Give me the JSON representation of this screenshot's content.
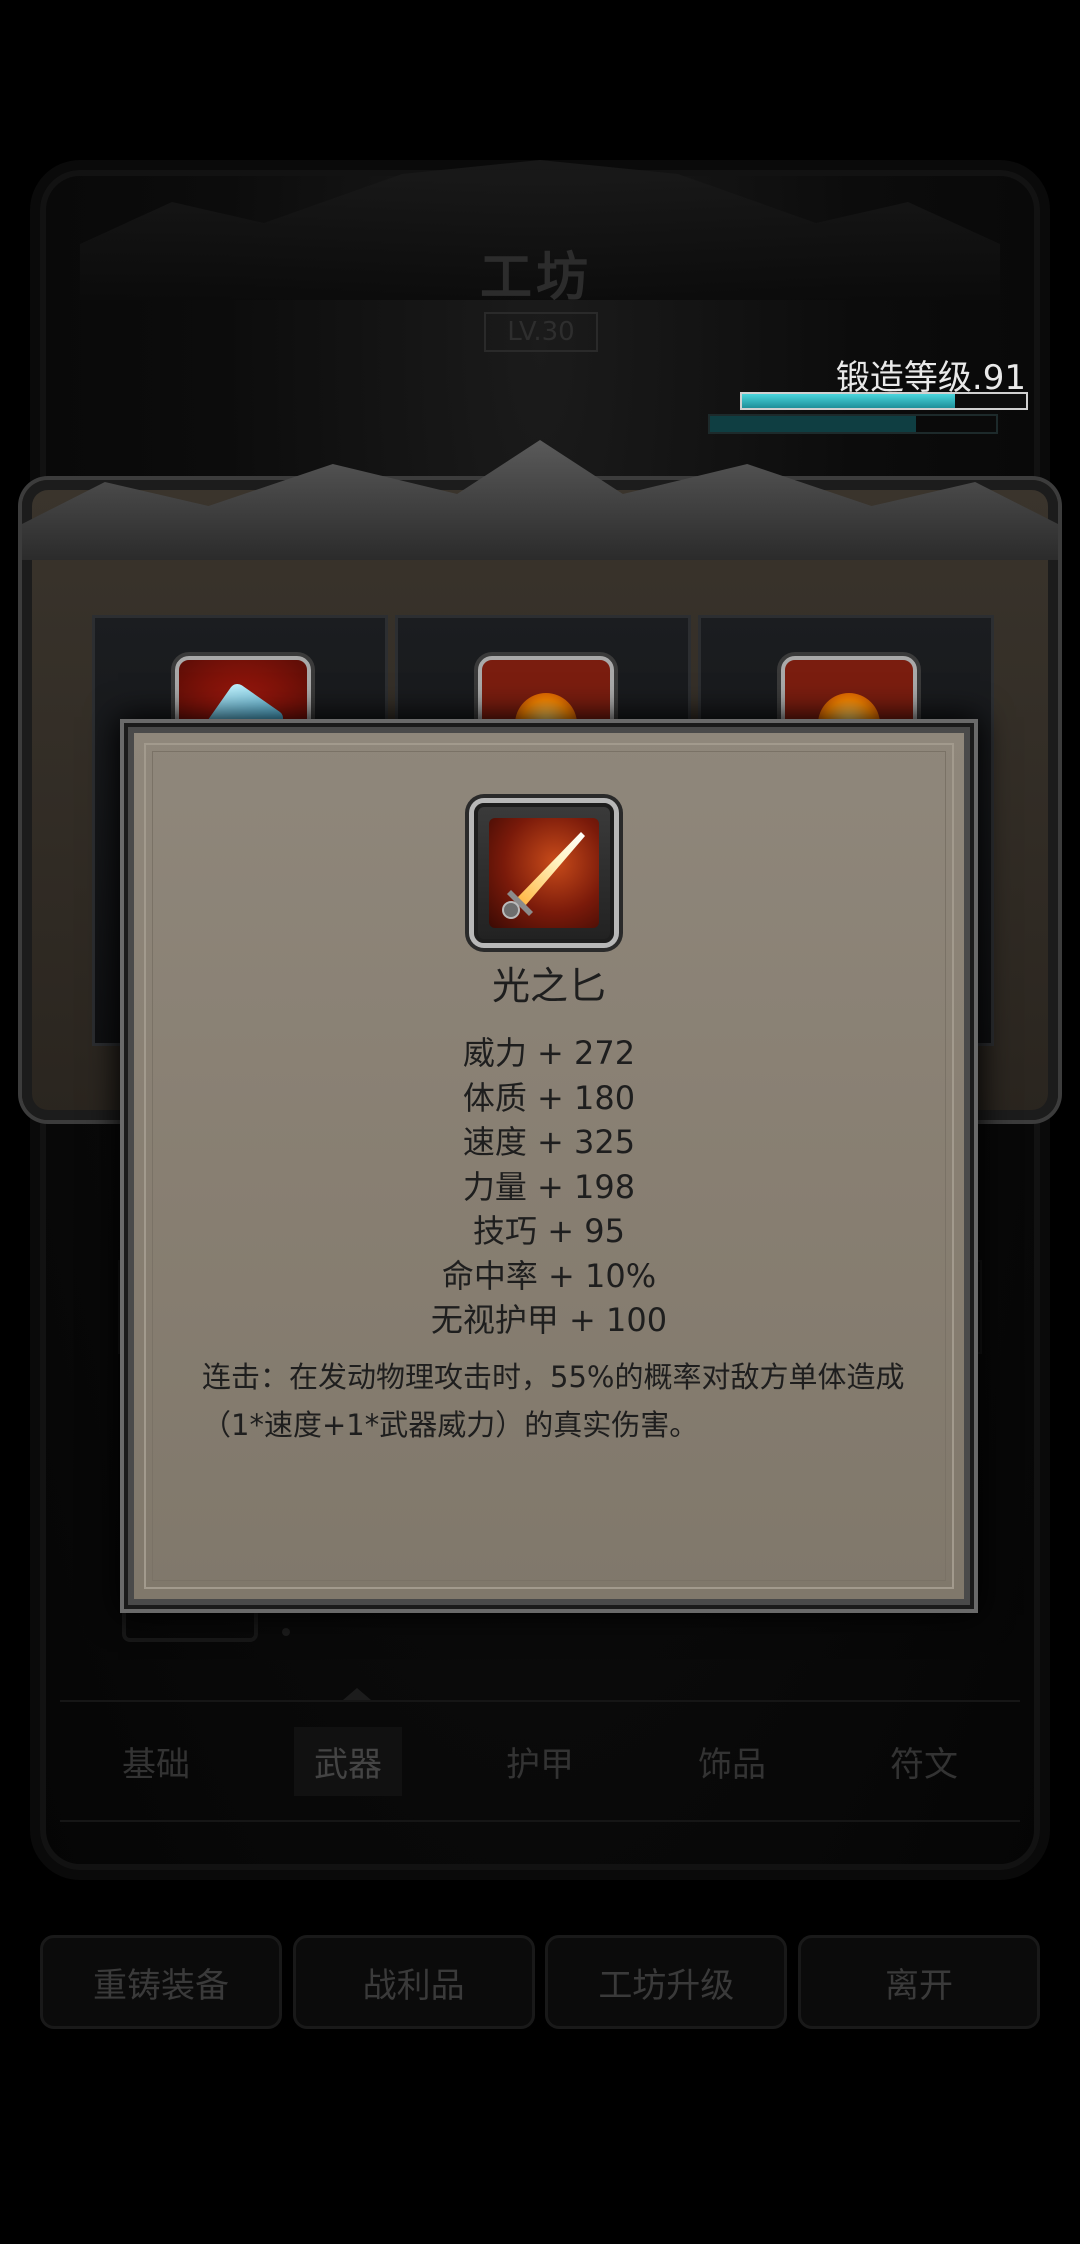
{
  "background": {
    "title": "工坊",
    "level": "LV.30",
    "forge_label": "锻造等级.91",
    "forge_progress": 0.75,
    "forge_progress_secondary": 0.72,
    "tabs": [
      "基础",
      "武器",
      "护甲",
      "饰品",
      "符文"
    ],
    "active_tab": 1,
    "actions": [
      "重铸装备",
      "战利品",
      "工坊升级",
      "离开"
    ],
    "slots": [
      {
        "icon": "ice-crystal-icon"
      },
      {
        "icon": "fire-rune-icon"
      },
      {
        "icon": "fire-rune-icon"
      }
    ]
  },
  "popup": {
    "icon": "golden-dagger-icon",
    "item_name": "光之匕",
    "stats": [
      "威力 + 272",
      "体质 + 180",
      "速度 + 325",
      "力量 + 198",
      "技巧 + 95",
      "命中率 + 10%",
      "无视护甲 + 100"
    ],
    "description": "连击：在发动物理攻击时，55%的概率对敌方单体造成（1*速度+1*武器威力）的真实伤害。"
  },
  "colors": {
    "popup_bg": "#887f72",
    "forge_bar": "#2fb6bf",
    "text_dark": "#1e1e1e"
  }
}
